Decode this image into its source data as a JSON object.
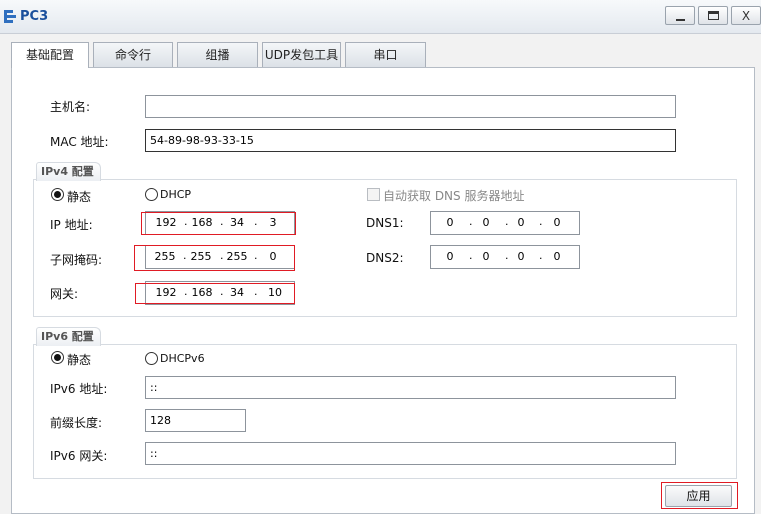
{
  "window": {
    "title": "PC3",
    "minimize_icon": "minimize-icon",
    "maximize_icon": "maximize-icon",
    "close_glyph": "X"
  },
  "tabs": [
    {
      "label": "基础配置",
      "active": true
    },
    {
      "label": "命令行",
      "active": false
    },
    {
      "label": "组播",
      "active": false
    },
    {
      "label": "UDP发包工具",
      "active": false
    },
    {
      "label": "串口",
      "active": false
    }
  ],
  "basic": {
    "hostname_label": "主机名:",
    "hostname_value": "",
    "mac_label": "MAC 地址:",
    "mac_value": "54-89-98-93-33-15"
  },
  "ipv4": {
    "group_title": "IPv4 配置",
    "static_label": "静态",
    "dhcp_label": "DHCP",
    "selected": "static",
    "auto_dns_label": "自动获取 DNS 服务器地址",
    "auto_dns_checked": false,
    "ip_label": "IP 地址:",
    "ip": [
      "192",
      "168",
      "34",
      "3"
    ],
    "mask_label": "子网掩码:",
    "mask": [
      "255",
      "255",
      "255",
      "0"
    ],
    "gateway_label": "网关:",
    "gateway": [
      "192",
      "168",
      "34",
      "10"
    ],
    "dns1_label": "DNS1:",
    "dns1": [
      "0",
      "0",
      "0",
      "0"
    ],
    "dns2_label": "DNS2:",
    "dns2": [
      "0",
      "0",
      "0",
      "0"
    ]
  },
  "ipv6": {
    "group_title": "IPv6 配置",
    "static_label": "静态",
    "dhcp_label": "DHCPv6",
    "selected": "static",
    "addr_label": "IPv6 地址:",
    "addr_value": "::",
    "prefix_label": "前缀长度:",
    "prefix_value": "128",
    "gateway_label": "IPv6 网关:",
    "gateway_value": "::"
  },
  "apply_label": "应用",
  "colors": {
    "highlight_border": "#e01b24",
    "title_text": "#1a4f9c"
  }
}
